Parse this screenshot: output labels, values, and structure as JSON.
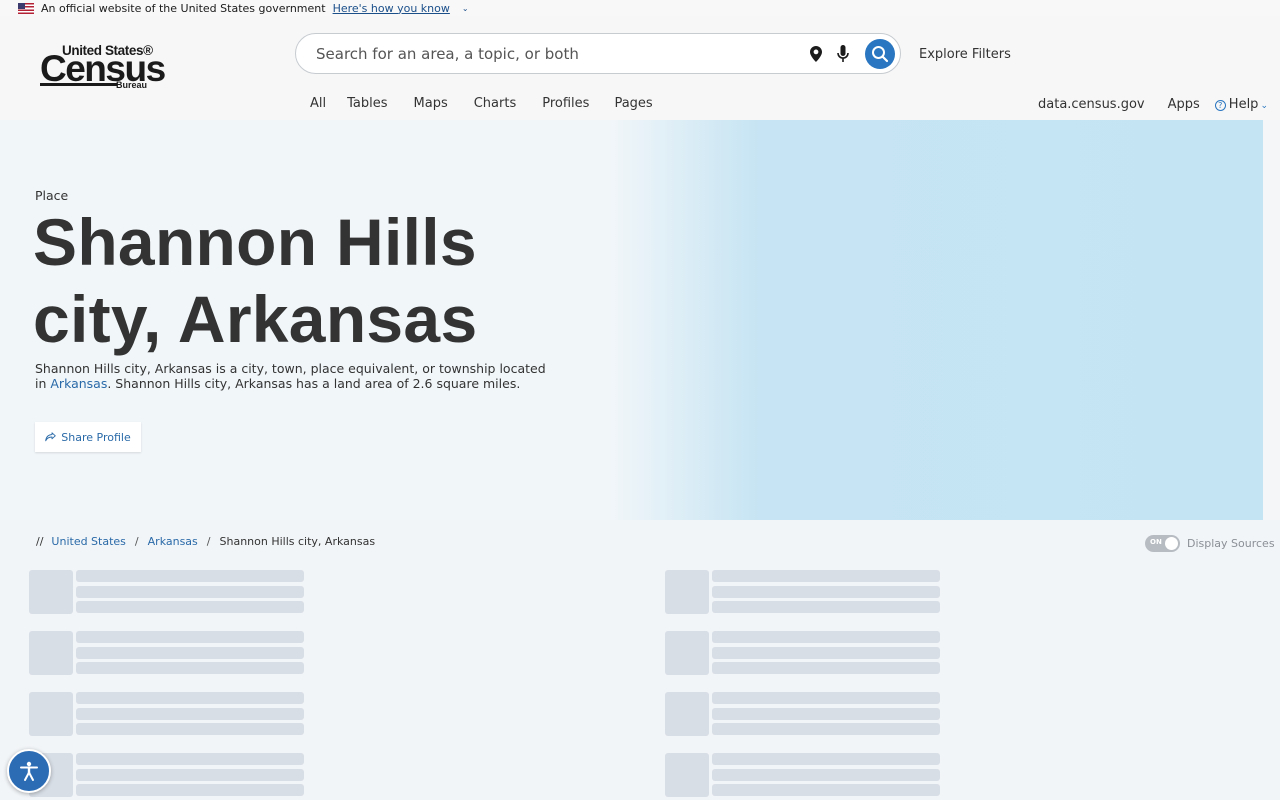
{
  "gov_banner": {
    "text": "An official website of the United States government",
    "link": "Here's how you know"
  },
  "logo": {
    "top": "United States®",
    "main": "Census",
    "bottom": "Bureau"
  },
  "search": {
    "placeholder": "Search for an area, a topic, or both",
    "icons": [
      "location-pin-icon",
      "microphone-icon",
      "search-icon"
    ],
    "explore_filters": "Explore Filters"
  },
  "tabs": [
    "All",
    "Tables",
    "Maps",
    "Charts",
    "Profiles",
    "Pages"
  ],
  "right_nav": {
    "data_site": "data.census.gov",
    "apps": "Apps",
    "help": "Help"
  },
  "hero": {
    "label": "Place",
    "title": "Shannon Hills city, Arkansas",
    "desc_start": "Shannon Hills city, Arkansas is a city, town, place equivalent, or township located in ",
    "desc_link": "Arkansas",
    "desc_end": ". Shannon Hills city, Arkansas has a land area of 2.6 square miles.",
    "share_label": "Share Profile"
  },
  "breadcrumb": {
    "prefix": "//",
    "items": [
      "United States",
      "Arkansas",
      "Shannon Hills city, Arkansas"
    ]
  },
  "display_sources": {
    "toggle_text": "ON",
    "label": "Display Sources"
  },
  "colors": {
    "accent": "#2a76c0",
    "link": "#2a6aa8",
    "hero_right": "#c4e4f4",
    "skeleton": "#d8dee6"
  }
}
